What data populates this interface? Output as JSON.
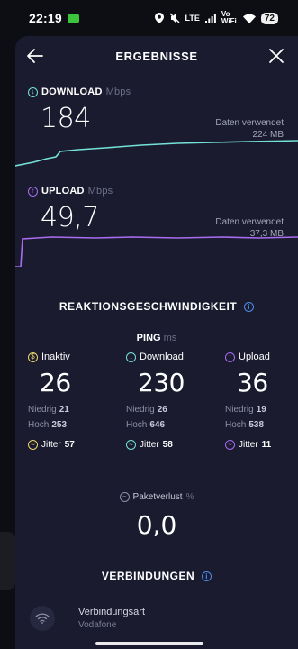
{
  "status_bar": {
    "time": "22:19",
    "network": "LTE",
    "volte": "Vo WiFi",
    "battery": "72"
  },
  "header": {
    "title": "ERGEBNISSE",
    "back_icon": "arrow-left-icon",
    "close_icon": "close-icon"
  },
  "download": {
    "label": "DOWNLOAD",
    "unit": "Mbps",
    "value": "184",
    "data_used_label": "Daten verwendet",
    "data_used_value": "224 MB",
    "color": "#74e2d8"
  },
  "upload": {
    "label": "UPLOAD",
    "unit": "Mbps",
    "value": "49,7",
    "data_used_label": "Daten verwendet",
    "data_used_value": "37,3 MB",
    "color": "#a86cf0"
  },
  "reaction": {
    "title": "REAKTIONSGESCHWINDIGKEIT",
    "ping_label": "PING",
    "ping_unit": "ms",
    "columns": [
      {
        "label": "Inaktiv",
        "value": "26",
        "low_label": "Niedrig",
        "low": "21",
        "high_label": "Hoch",
        "high": "253",
        "jitter_label": "Jitter",
        "jitter": "57",
        "color": "#e8d46a"
      },
      {
        "label": "Download",
        "value": "230",
        "low_label": "Niedrig",
        "low": "26",
        "high_label": "Hoch",
        "high": "646",
        "jitter_label": "Jitter",
        "jitter": "58",
        "color": "#74e2d8"
      },
      {
        "label": "Upload",
        "value": "36",
        "low_label": "Niedrig",
        "low": "19",
        "high_label": "Hoch",
        "high": "538",
        "jitter_label": "Jitter",
        "jitter": "11",
        "color": "#a86cf0"
      }
    ],
    "loss_label": "Paketverlust",
    "loss_unit": "%",
    "loss_value": "0,0"
  },
  "connections": {
    "title": "VERBINDUNGEN",
    "type_label": "Verbindungsart",
    "type_value": "Vodafone"
  }
}
